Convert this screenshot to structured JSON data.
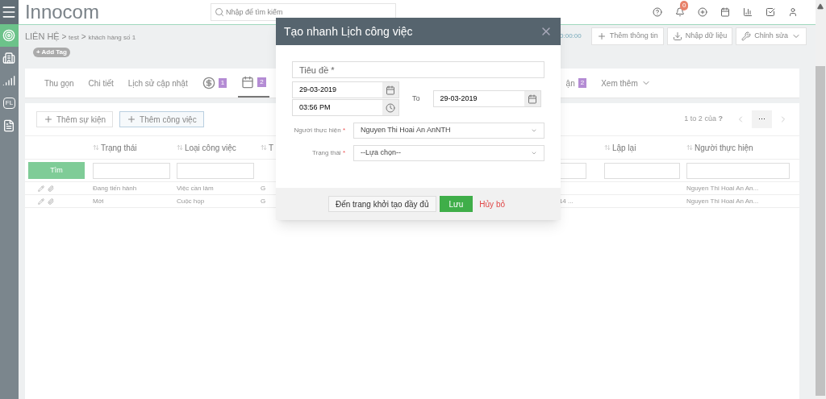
{
  "header": {
    "logo": "Innocom",
    "search": {
      "placeholder": "Nhập để tìm kiếm"
    },
    "notifications": "0"
  },
  "sidebar": {
    "items": [
      {
        "kind": "target",
        "selected": true
      },
      {
        "kind": "building",
        "selected": false
      },
      {
        "kind": "signal",
        "selected": false
      },
      {
        "kind": "fl",
        "label": "FL",
        "selected": false
      },
      {
        "kind": "document",
        "selected": false
      }
    ]
  },
  "breadcrumb": [
    "LIÊN HỆ",
    "test",
    "khách hàng số 1"
  ],
  "breadcrumb_separator": ">",
  "add_tag": "+ Add Tag",
  "toolbar": {
    "time": "0:00:00",
    "buttons": [
      {
        "kind": "plus",
        "label": "Thêm thông tin"
      },
      {
        "kind": "download",
        "label": "Nhập dữ liệu"
      },
      {
        "kind": "wrench",
        "label": "Chỉnh sửa",
        "dropdown": true
      }
    ]
  },
  "tabs": [
    {
      "kind": "text",
      "label": "Thu gọn",
      "selected": false
    },
    {
      "kind": "text",
      "label": "Chi tiết",
      "selected": false
    },
    {
      "kind": "text",
      "label": "Lịch sử cập nhật",
      "selected": false
    },
    {
      "kind": "money",
      "badge": "1",
      "selected": false
    },
    {
      "kind": "calendar",
      "badge": "2",
      "selected": true
    }
  ],
  "tabs_right": [
    {
      "kind": "text",
      "label": "ận",
      "badge": "2",
      "selected": false
    },
    {
      "kind": "more",
      "label": "Xem thêm",
      "selected": false
    }
  ],
  "actions": [
    "Thêm sự kiện",
    "Thêm công việc"
  ],
  "pagination": {
    "range": "1 to 2",
    "of": "của",
    "total": "?",
    "more": "···"
  },
  "table": {
    "search_button": "Tìm",
    "columns": [
      "Trạng thái",
      "Loại công việc",
      "T",
      "",
      "Lập lại",
      "Người thực hiện"
    ],
    "rows": [
      {
        "cells": [
          "Đang tiến hành",
          "Việc cần làm",
          "G",
          "",
          "",
          "Nguyen Thi Hoai An An..."
        ]
      },
      {
        "cells": [
          "Mới",
          "Cuộc họp",
          "G",
          "14 ...",
          "",
          "Nguyen Thi Hoai An An..."
        ]
      }
    ]
  },
  "modal": {
    "title": "Tạo nhanh Lịch công việc",
    "required_mark": "*",
    "title_field": {
      "placeholder": "Tiêu đề *"
    },
    "start_date": "29-03-2019",
    "start_time": "03:56 PM",
    "to_label": "To",
    "end_date": "29-03-2019",
    "assignee": {
      "label": "Người thực hiện",
      "required": true,
      "value": "Nguyen Thi Hoai An AnNTH"
    },
    "status": {
      "label": "Trạng thái",
      "required": true,
      "value": "--Lựa chọn--"
    },
    "buttons": [
      {
        "kind": "default",
        "label": "Đến trang khởi tạo đầy đủ"
      },
      {
        "kind": "primary",
        "label": "Lưu"
      },
      {
        "kind": "link",
        "label": "Hủy bỏ"
      }
    ]
  }
}
